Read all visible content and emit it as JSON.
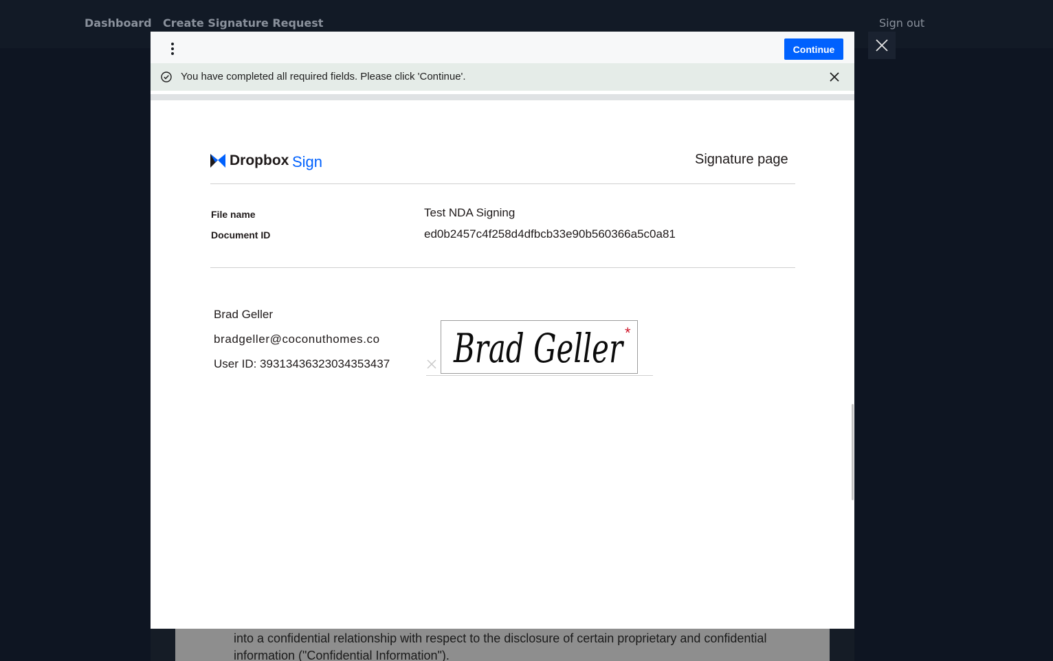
{
  "nav": {
    "dashboard": "Dashboard",
    "create_request": "Create Signature Request",
    "sign_out": "Sign out"
  },
  "modal": {
    "continue_label": "Continue",
    "banner_text": "You have completed all required fields. Please click 'Continue'.",
    "brand_primary": "#0061fe"
  },
  "document": {
    "logo_word": "Dropbox",
    "logo_sign": "Sign",
    "page_title": "Signature page",
    "file_name_label": "File name",
    "file_name_value": "Test NDA Signing",
    "doc_id_label": "Document ID",
    "doc_id_value": "ed0b2457c4f258d4dfbcb33e90b560366a5c0a81",
    "signer_name": "Brad Geller",
    "signer_email": "bradgeller@coconuthomes.co",
    "signer_user_id": "User ID: 39313436323034353437",
    "signature_text": "Brad Geller",
    "required_marker": "*"
  },
  "background_doc": {
    "line1": "into a confidential relationship with respect to the disclosure of certain proprietary and confidential",
    "line2": "information (\"Confidential Information\")."
  }
}
